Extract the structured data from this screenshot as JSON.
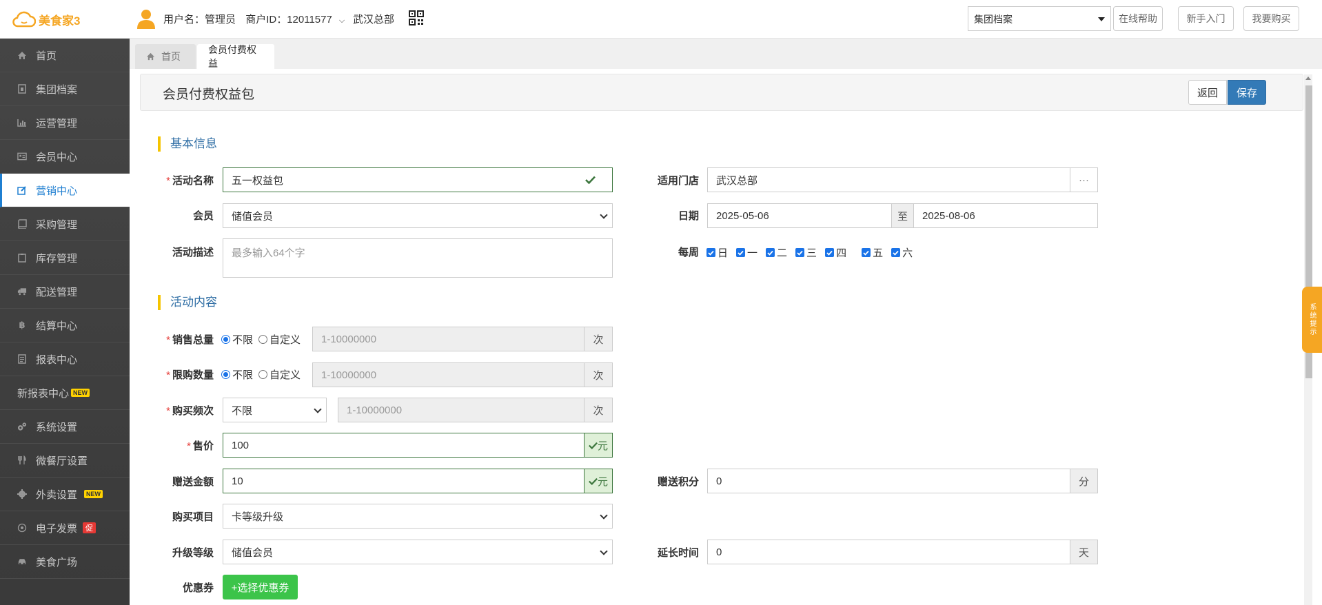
{
  "header": {
    "logo_text": "美食家3",
    "username": "用户名：管理员",
    "merchant": "商户ID：12011577",
    "store": "武汉总部",
    "top_select": "集团档案",
    "help": "在线帮助",
    "guide": "新手入门",
    "buy": "我要购买"
  },
  "sidebar": {
    "items": [
      {
        "label": "首页",
        "icon": "home-icon"
      },
      {
        "label": "集团档案",
        "icon": "file-icon"
      },
      {
        "label": "运营管理",
        "icon": "bar-chart-icon"
      },
      {
        "label": "会员中心",
        "icon": "id-card-icon"
      },
      {
        "label": "营销中心",
        "icon": "edit-icon"
      },
      {
        "label": "采购管理",
        "icon": "book-icon"
      },
      {
        "label": "库存管理",
        "icon": "clipboard-icon"
      },
      {
        "label": "配送管理",
        "icon": "truck-icon"
      },
      {
        "label": "结算中心",
        "icon": "bitcoin-icon"
      },
      {
        "label": "报表中心",
        "icon": "file-text-icon"
      },
      {
        "label": "新报表中心",
        "badge": "NEW"
      },
      {
        "label": "系统设置",
        "icon": "gears-icon"
      },
      {
        "label": "微餐厅设置",
        "icon": "cutlery-icon"
      },
      {
        "label": "外卖设置",
        "icon": "gear-icon",
        "badge": "NEW"
      },
      {
        "label": "电子发票",
        "icon": "sun-icon",
        "badge": "促"
      },
      {
        "label": "美食广场",
        "icon": "car-icon"
      }
    ]
  },
  "tabs": {
    "home": "首页",
    "current": "会员付费权益"
  },
  "page": {
    "title": "会员付费权益包",
    "back": "返回",
    "save": "保存"
  },
  "basic": {
    "section": "基本信息",
    "name_label": "活动名称",
    "name_value": "五一权益包",
    "store_label": "适用门店",
    "store_value": "武汉总部",
    "store_more": "···",
    "member_label": "会员",
    "member_value": "储值会员",
    "date_label": "日期",
    "date_start": "2025-05-06",
    "date_to": "至",
    "date_end": "2025-08-06",
    "desc_label": "活动描述",
    "desc_placeholder": "最多输入64个字",
    "week_label": "每周",
    "weekdays": [
      "日",
      "一",
      "二",
      "三",
      "四",
      "五",
      "六"
    ]
  },
  "content": {
    "section": "活动内容",
    "total_label": "销售总量",
    "limit_label": "限购数量",
    "radio_unlimited": "不限",
    "radio_custom": "自定义",
    "range_placeholder": "1-10000000",
    "unit_times": "次",
    "freq_label": "购买频次",
    "freq_value": "不限",
    "price_label": "售价",
    "price_value": "100",
    "unit_yuan": "元",
    "gift_label": "赠送金额",
    "gift_value": "10",
    "points_label": "赠送积分",
    "points_value": "0",
    "unit_points": "分",
    "item_label": "购买项目",
    "item_value": "卡等级升级",
    "level_label": "升级等级",
    "level_value": "储值会员",
    "extend_label": "延长时间",
    "extend_value": "0",
    "unit_day": "天",
    "coupon_label": "优惠券",
    "coupon_button": "+选择优惠券"
  },
  "system_tip": "系统提示"
}
